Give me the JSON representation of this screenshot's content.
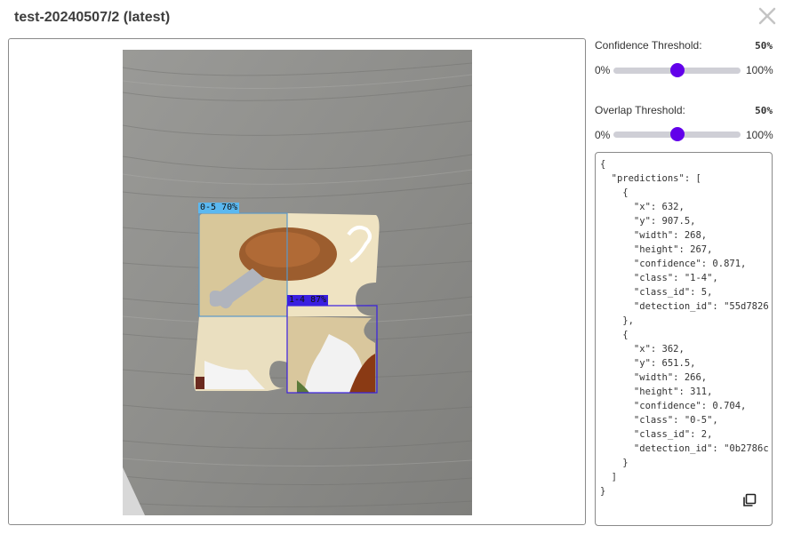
{
  "header": {
    "title": "test-20240507/2 (latest)",
    "close_icon": "close-icon"
  },
  "confidence": {
    "label": "Confidence Threshold:",
    "value_text": "50%",
    "value": 0.5,
    "min_label": "0%",
    "max_label": "100%"
  },
  "overlap": {
    "label": "Overlap Threshold:",
    "value_text": "50%",
    "value": 0.5,
    "min_label": "0%",
    "max_label": "100%"
  },
  "detections": [
    {
      "label": "0-5 70%",
      "color": "#5bb8f0"
    },
    {
      "label": "1-4 87%",
      "color": "#3a1fe0"
    }
  ],
  "json_output": "{\n  \"predictions\": [\n    {\n      \"x\": 632,\n      \"y\": 907.5,\n      \"width\": 268,\n      \"height\": 267,\n      \"confidence\": 0.871,\n      \"class\": \"1-4\",\n      \"class_id\": 5,\n      \"detection_id\": \"55d7826\n    },\n    {\n      \"x\": 362,\n      \"y\": 651.5,\n      \"width\": 266,\n      \"height\": 311,\n      \"confidence\": 0.704,\n      \"class\": \"0-5\",\n      \"class_id\": 2,\n      \"detection_id\": \"0b2786c\n    }\n  ]\n}",
  "copy_icon": "copy-icon",
  "colors": {
    "accent": "#6200ea",
    "track": "#cfcfd6",
    "wood": "#8f8f8c"
  }
}
